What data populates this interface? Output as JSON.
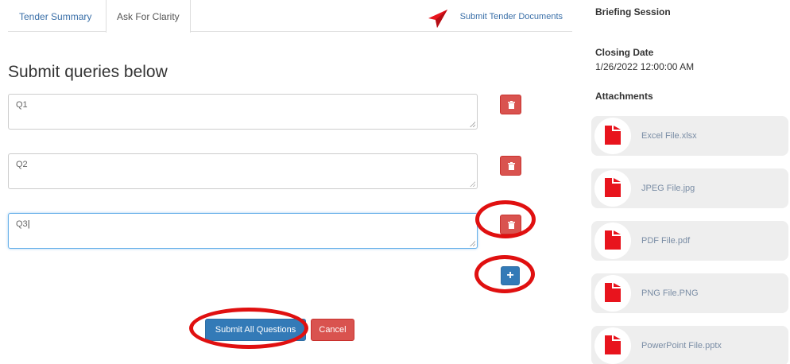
{
  "tabs": {
    "tender_summary": "Tender Summary",
    "ask_for_clarity": "Ask For Clarity",
    "submit_tender_documents": "Submit Tender Documents"
  },
  "main": {
    "heading": "Submit queries below",
    "queries": [
      {
        "value": "Q1"
      },
      {
        "value": "Q2"
      },
      {
        "value": "Q3"
      }
    ],
    "add_button_label": "+",
    "submit_label": "Submit All Questions",
    "cancel_label": "Cancel"
  },
  "sidebar": {
    "briefing_label": "Briefing Session",
    "closing_label": "Closing Date",
    "closing_value": "1/26/2022 12:00:00 AM",
    "attachments_label": "Attachments",
    "attachments": [
      {
        "name": "Excel File.xlsx",
        "icon": "document-icon"
      },
      {
        "name": "JPEG File.jpg",
        "icon": "document-icon"
      },
      {
        "name": "PDF File.pdf",
        "icon": "document-icon"
      },
      {
        "name": "PNG File.PNG",
        "icon": "document-icon"
      },
      {
        "name": "PowerPoint File.pptx",
        "icon": "document-icon"
      }
    ]
  },
  "colors": {
    "primary": "#337ab7",
    "danger": "#d9534f",
    "annotation": "#e01010",
    "doc_icon": "#e8141d"
  }
}
